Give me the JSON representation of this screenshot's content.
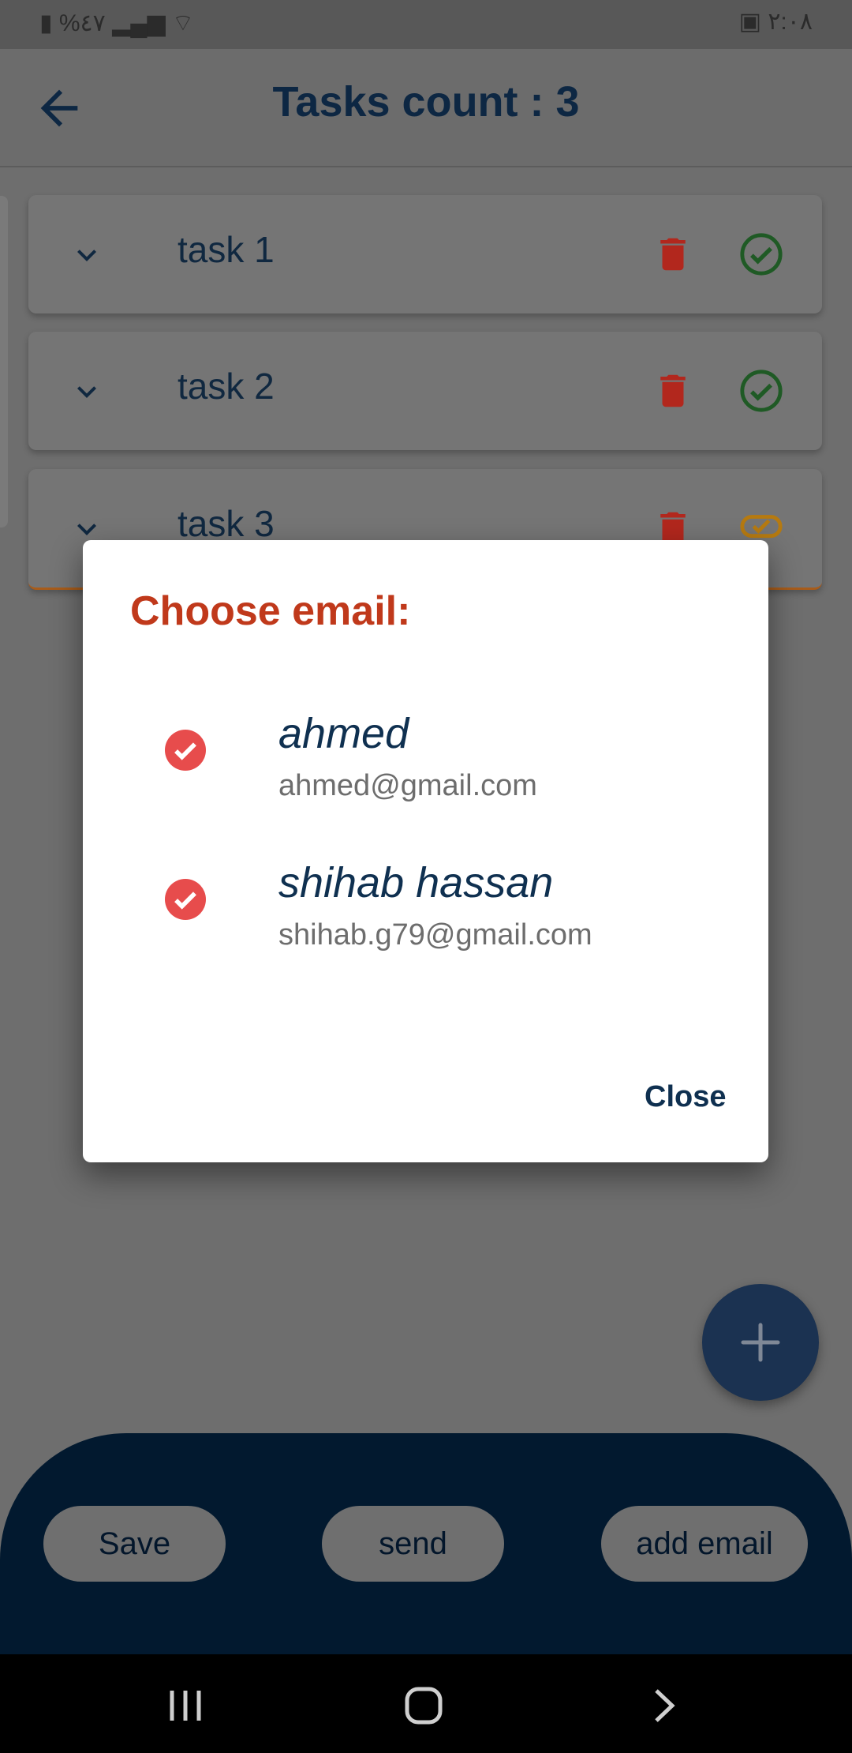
{
  "status_bar": {
    "left_text": "%٤٧",
    "time": "٢:٠٨"
  },
  "app_bar": {
    "title": "Tasks count : 3"
  },
  "tasks": [
    {
      "label": "task 1",
      "status": "done"
    },
    {
      "label": "task 2",
      "status": "done"
    },
    {
      "label": "task 3",
      "status": "pending"
    }
  ],
  "dialog": {
    "title": "Choose email:",
    "emails": [
      {
        "name": "ahmed",
        "address": "ahmed@gmail.com",
        "checked": true
      },
      {
        "name": "shihab hassan",
        "address": "shihab.g79@gmail.com",
        "checked": true
      }
    ],
    "close_label": "Close"
  },
  "bottom_bar": {
    "save_label": "Save",
    "send_label": "send",
    "add_email_label": "add email"
  },
  "colors": {
    "primary_dark": "#02192f",
    "title_accent": "#c0391b",
    "check_red": "#e74c4c",
    "delete_red": "#b2271d",
    "done_green": "#1f5a25",
    "pending_orange": "#b67a10"
  }
}
